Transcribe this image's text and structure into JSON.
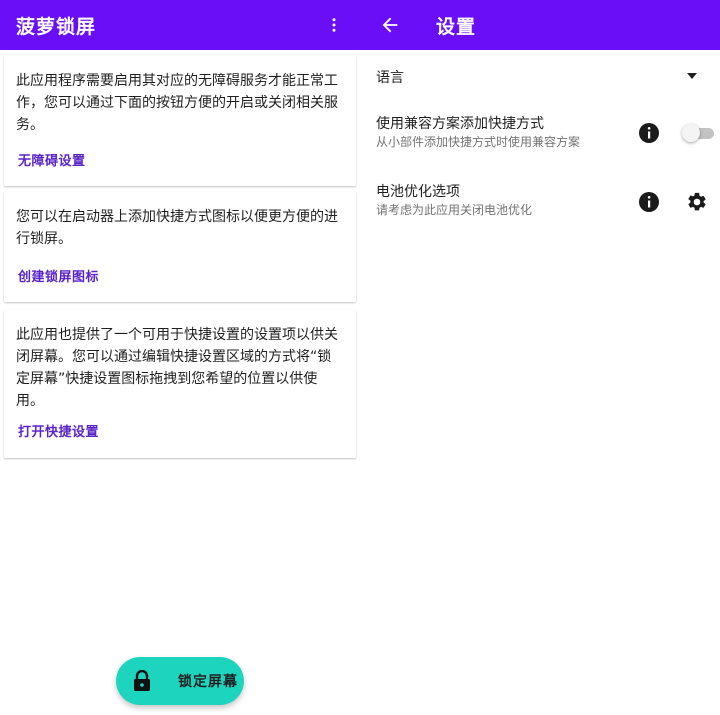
{
  "left": {
    "appbar": {
      "title": "菠萝锁屏",
      "overflow_icon": "more-vert-icon"
    },
    "cards": [
      {
        "text": "此应用程序需要启用其对应的无障碍服务才能正常工作，您可以通过下面的按钮方便的开启或关闭相关服务。",
        "action": "无障碍设置"
      },
      {
        "text": "您可以在启动器上添加快捷方式图标以便更方便的进行锁屏。",
        "action": "创建锁屏图标"
      },
      {
        "text": "此应用也提供了一个可用于快捷设置的设置项以供关闭屏幕。您可以通过编辑快捷设置区域的方式将“锁定屏幕”快捷设置图标拖拽到您希望的位置以供使用。",
        "action": "打开快捷设置"
      }
    ],
    "fab": {
      "label": "锁定屏幕",
      "icon": "lock-icon"
    }
  },
  "right": {
    "appbar": {
      "title": "设置",
      "back_icon": "arrow-back-icon"
    },
    "prefs": {
      "language": {
        "title": "语言",
        "icon": "dropdown-arrow-icon"
      },
      "shortcut": {
        "title": "使用兼容方案添加快捷方式",
        "summary": "从小部件添加快捷方式时使用兼容方案",
        "switch_on": false,
        "icon": "info-icon"
      },
      "battery": {
        "title": "电池优化选项",
        "summary": "请考虑为此应用关闭电池优化",
        "icons": [
          "info-icon",
          "gear-icon"
        ]
      }
    }
  },
  "colors": {
    "appbar": "#6a0ef7",
    "accent_text": "#5a24c9",
    "fab": "#1dd5bf"
  }
}
